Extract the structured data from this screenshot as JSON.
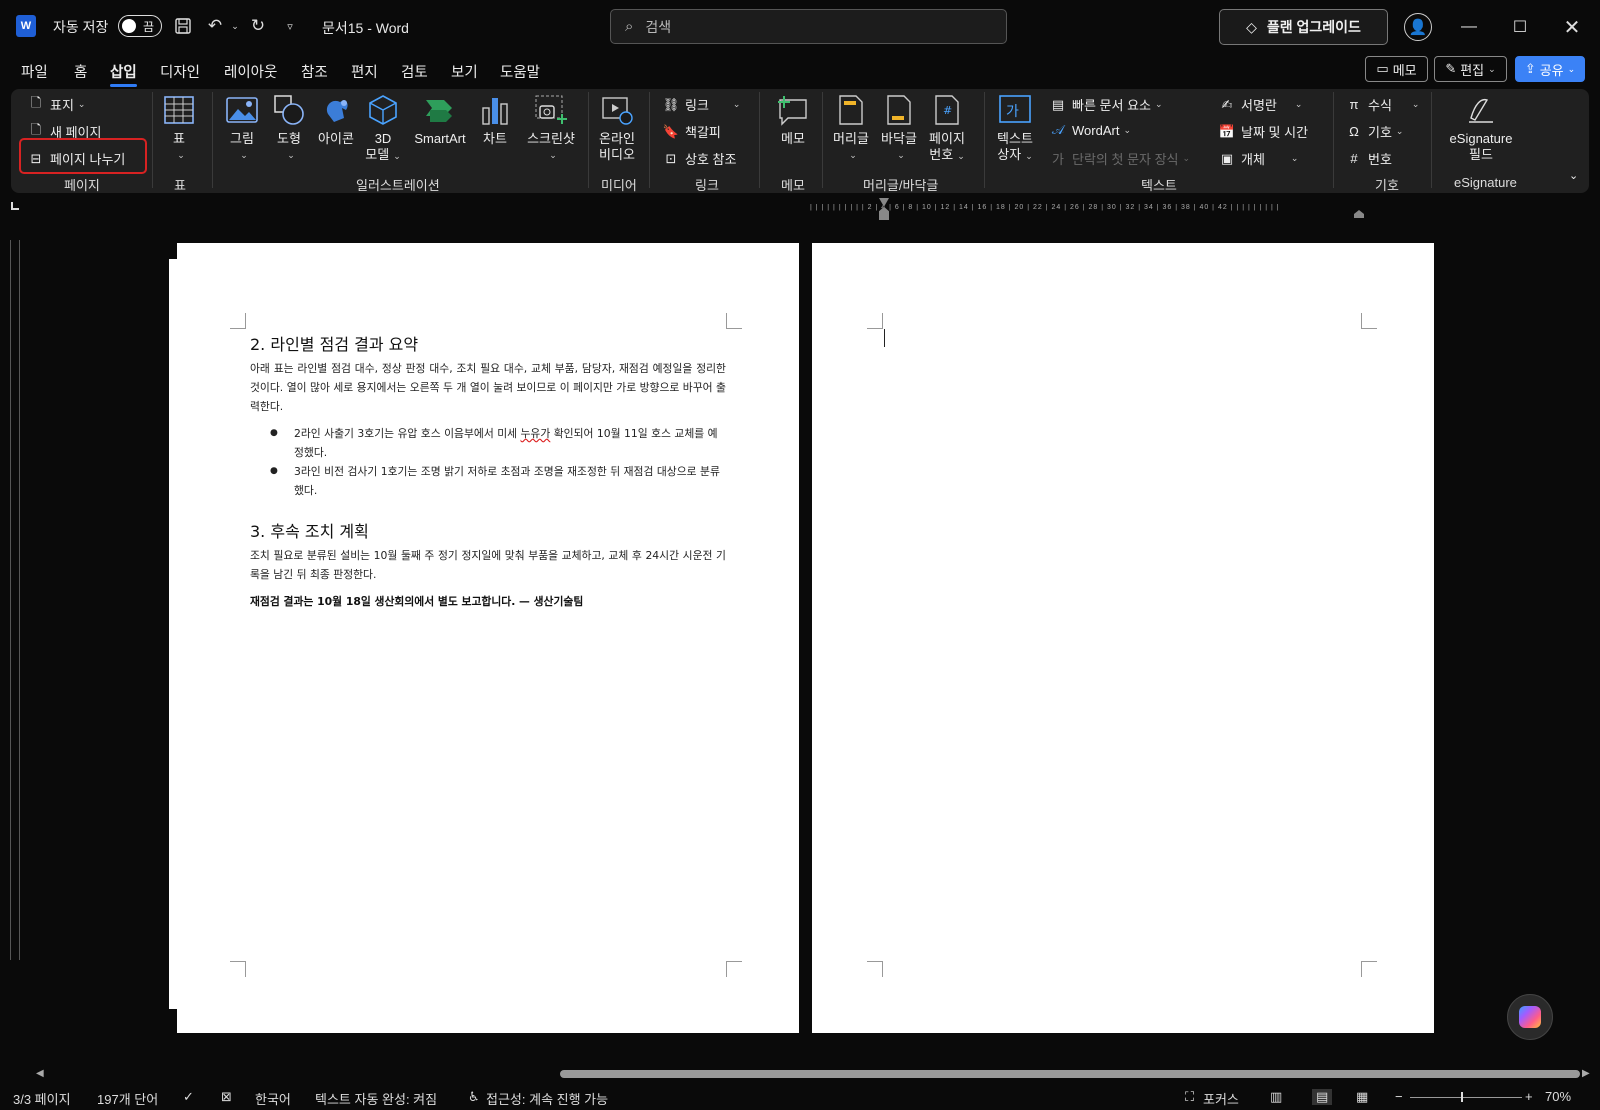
{
  "titlebar": {
    "logo": "W",
    "autosave_label": "자동 저장",
    "toggle_state": "끔",
    "doc_title": "문서15  -  Word",
    "search_placeholder": "검색",
    "upgrade_label": "플랜 업그레이드"
  },
  "menu": {
    "tabs": [
      "파일",
      "홈",
      "삽입",
      "디자인",
      "레이아웃",
      "참조",
      "편지",
      "검토",
      "보기",
      "도움말"
    ],
    "active_tab": "삽입",
    "memo_label": "메모",
    "edit_label": "편집",
    "share_label": "공유"
  },
  "ribbon": {
    "page_group": {
      "cover": "표지",
      "new_page": "새 페이지",
      "page_break": "페이지 나누기",
      "label": "페이지"
    },
    "table_group": {
      "table": "표",
      "label": "표"
    },
    "illustration_group": {
      "picture": "그림",
      "shapes": "도형",
      "icons": "아이콘",
      "model3d_line1": "3D",
      "model3d_line2": "모델",
      "smartart": "SmartArt",
      "chart": "차트",
      "screenshot": "스크린샷",
      "label": "일러스트레이션"
    },
    "media_group": {
      "online_video_line1": "온라인",
      "online_video_line2": "비디오",
      "label": "미디어"
    },
    "link_group": {
      "link": "링크",
      "bookmark": "책갈피",
      "crossref": "상호 참조",
      "label": "링크"
    },
    "memo_group": {
      "memo": "메모",
      "label": "메모"
    },
    "hf_group": {
      "header": "머리글",
      "footer": "바닥글",
      "page_no_line1": "페이지",
      "page_no_line2": "번호",
      "label": "머리글/바닥글"
    },
    "text_group": {
      "textbox_line1": "텍스트",
      "textbox_line2": "상자",
      "quickparts": "빠른 문서 요소",
      "wordart": "WordArt",
      "dropcap": "단락의 첫 문자 장식",
      "signature": "서명란",
      "datetime": "날짜 및 시간",
      "object": "개체",
      "label": "텍스트"
    },
    "symbol_group": {
      "equation": "수식",
      "symbol": "기호",
      "number": "번호",
      "label": "기호"
    },
    "esign_group": {
      "field_line1": "eSignature",
      "field_line2": "필드",
      "label": "eSignature"
    }
  },
  "ruler_text": "| | | | | | | | | |  2  |  4  |  6  |  8  | 10 | 12 | 14 | 16 | 18 | 20 | 22 | 24 | 26 | 28 | 30 | 32 | 34 | 36 | 38 | 40 | 42 | | | | | | | | |",
  "document": {
    "section2_title": "2. 라인별 점검 결과 요약",
    "section2_para": "아래 표는 라인별 점검 대수, 정상 판정 대수, 조치 필요 대수, 교체 부품, 담당자, 재점검 예정일을 정리한 것이다. 열이 많아 세로 용지에서는 오른쪽 두 개 열이 눌려 보이므로 이 페이지만 가로 방향으로 바꾸어 출력한다.",
    "bullet1_a": "2라인 사출기 3호기는 유압 호스 이음부에서 미세 ",
    "bullet1_squiggle": "누유가",
    "bullet1_b": " 확인되어 10월 11일 호스 교체를 예정했다.",
    "bullet2": "3라인 비전 검사기 1호기는 조명 밝기 저하로 초점과 조명을 재조정한 뒤 재점검 대상으로 분류했다.",
    "section3_title": "3. 후속 조치 계획",
    "section3_para": "조치 필요로 분류된 설비는 10월 둘째 주 정기 정지일에 맞춰 부품을 교체하고, 교체 후 24시간 시운전 기록을 남긴 뒤 최종 판정한다.",
    "closing": "재점검 결과는 10월 18일 생산회의에서 별도 보고합니다. — 생산기술팀"
  },
  "status": {
    "page": "3/3 페이지",
    "words": "197개 단어",
    "language": "한국어",
    "autocomplete": "텍스트 자동 완성: 켜짐",
    "accessibility": "접근성: 계속 진행 가능",
    "focus": "포커스",
    "zoom": "70%"
  },
  "colors": {
    "accent": "#2f7bf5",
    "highlight": "#d72222",
    "ribbon_bg": "#202020",
    "app_bg": "#0a0a0a"
  }
}
